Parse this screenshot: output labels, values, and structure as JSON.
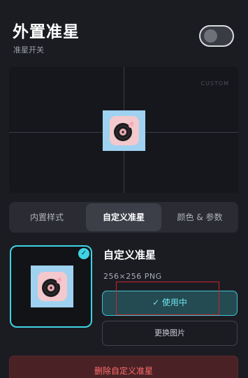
{
  "header": {
    "title": "外置准星",
    "subtitle": "准星开关",
    "toggle_on": false
  },
  "preview": {
    "label": "CUSTOM",
    "image_icon": "vinyl-record-icon"
  },
  "tabs": [
    {
      "label": "内置样式",
      "active": false
    },
    {
      "label": "自定义准星",
      "active": true
    },
    {
      "label": "颜色 & 参数",
      "active": false
    }
  ],
  "custom": {
    "name": "自定义准星",
    "meta": "256×256 PNG",
    "image_icon": "vinyl-record-icon",
    "selected_icon": "check-icon"
  },
  "actions": {
    "use_label": "✓ 使用中",
    "replace_label": "更换图片",
    "delete_label": "删除自定义准星"
  },
  "colors": {
    "background": "#1b1c22",
    "accent": "#3fd3e5",
    "danger": "#ff6b6b",
    "highlight": "#c9232a"
  }
}
